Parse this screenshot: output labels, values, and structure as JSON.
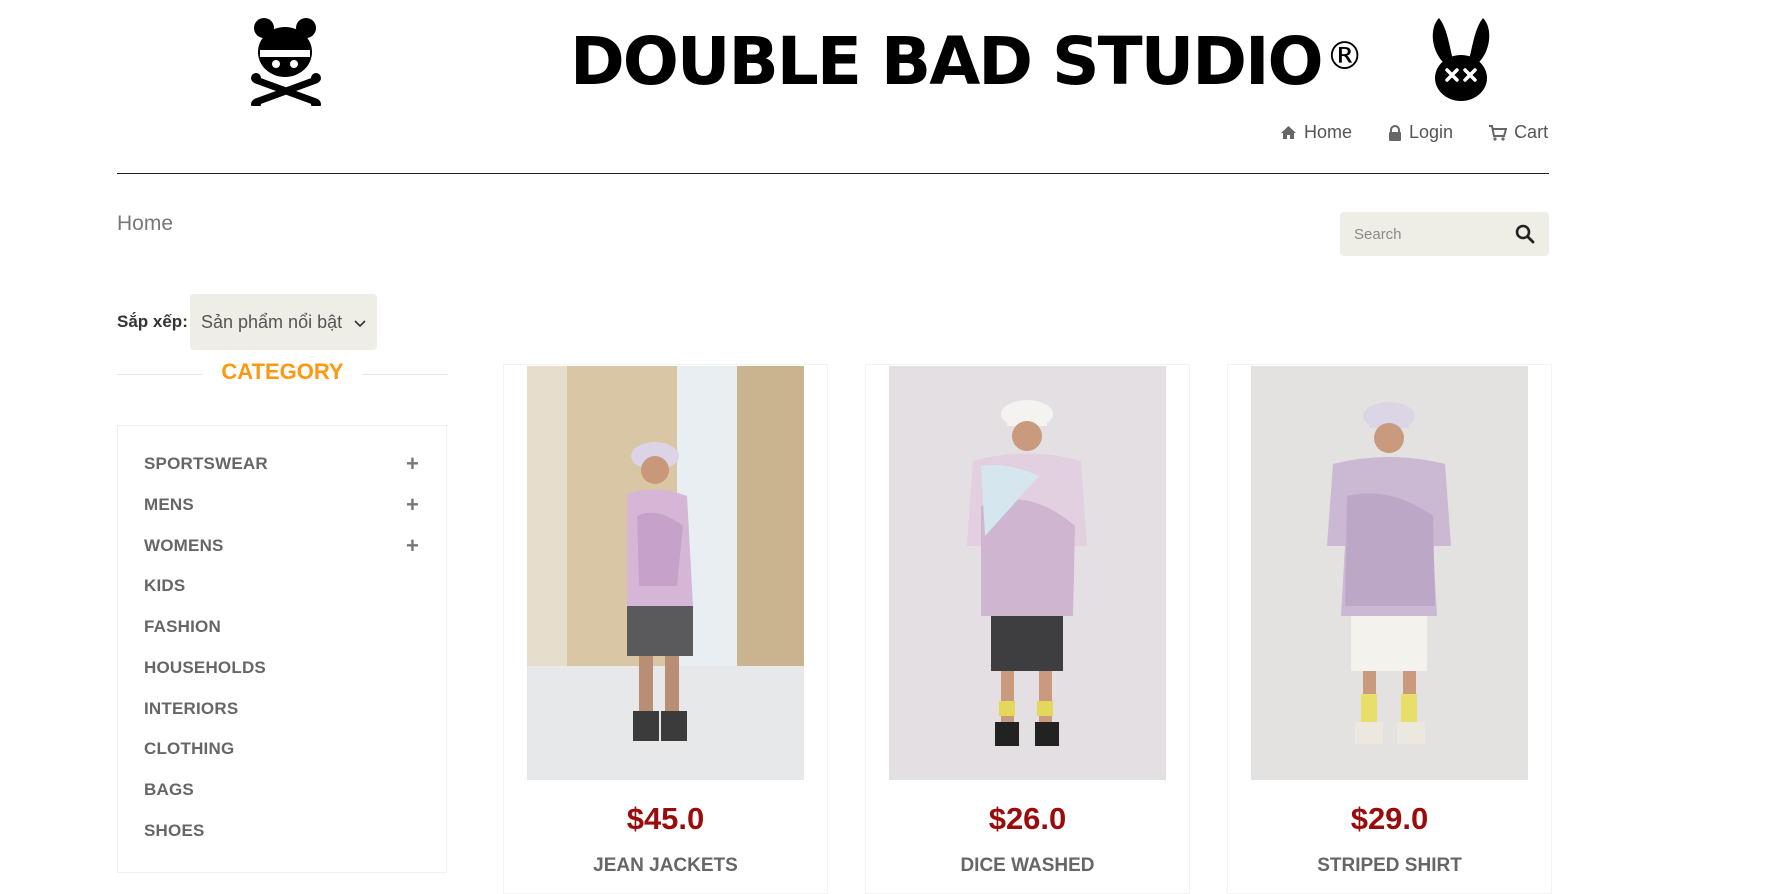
{
  "brand": {
    "name": "DOUBLE BAD STUDIO",
    "mark": "®"
  },
  "nav": [
    {
      "label": "Home",
      "icon": "home-icon"
    },
    {
      "label": "Login",
      "icon": "lock-icon"
    },
    {
      "label": "Cart",
      "icon": "cart-icon"
    }
  ],
  "breadcrumb": "Home",
  "search": {
    "placeholder": "Search"
  },
  "sort": {
    "label": "Sắp xếp:",
    "selected": "Sản phẩm nổi bật"
  },
  "category": {
    "title": "CATEGORY",
    "items": [
      {
        "label": "SPORTSWEAR",
        "expandable": true
      },
      {
        "label": "MENS",
        "expandable": true
      },
      {
        "label": "WOMENS",
        "expandable": true
      },
      {
        "label": "KIDS",
        "expandable": false
      },
      {
        "label": "FASHION",
        "expandable": false
      },
      {
        "label": "HOUSEHOLDS",
        "expandable": false
      },
      {
        "label": "INTERIORS",
        "expandable": false
      },
      {
        "label": "CLOTHING",
        "expandable": false
      },
      {
        "label": "BAGS",
        "expandable": false
      },
      {
        "label": "SHOES",
        "expandable": false
      }
    ]
  },
  "products": [
    {
      "price": "$45.0",
      "name": "JEAN JACKETS"
    },
    {
      "price": "$26.0",
      "name": "DICE WASHED"
    },
    {
      "price": "$29.0",
      "name": "STRIPED SHIRT"
    }
  ],
  "colors": {
    "accent": "#FE980F",
    "price": "#9a0b0b",
    "search_bg": "#eeede6"
  }
}
